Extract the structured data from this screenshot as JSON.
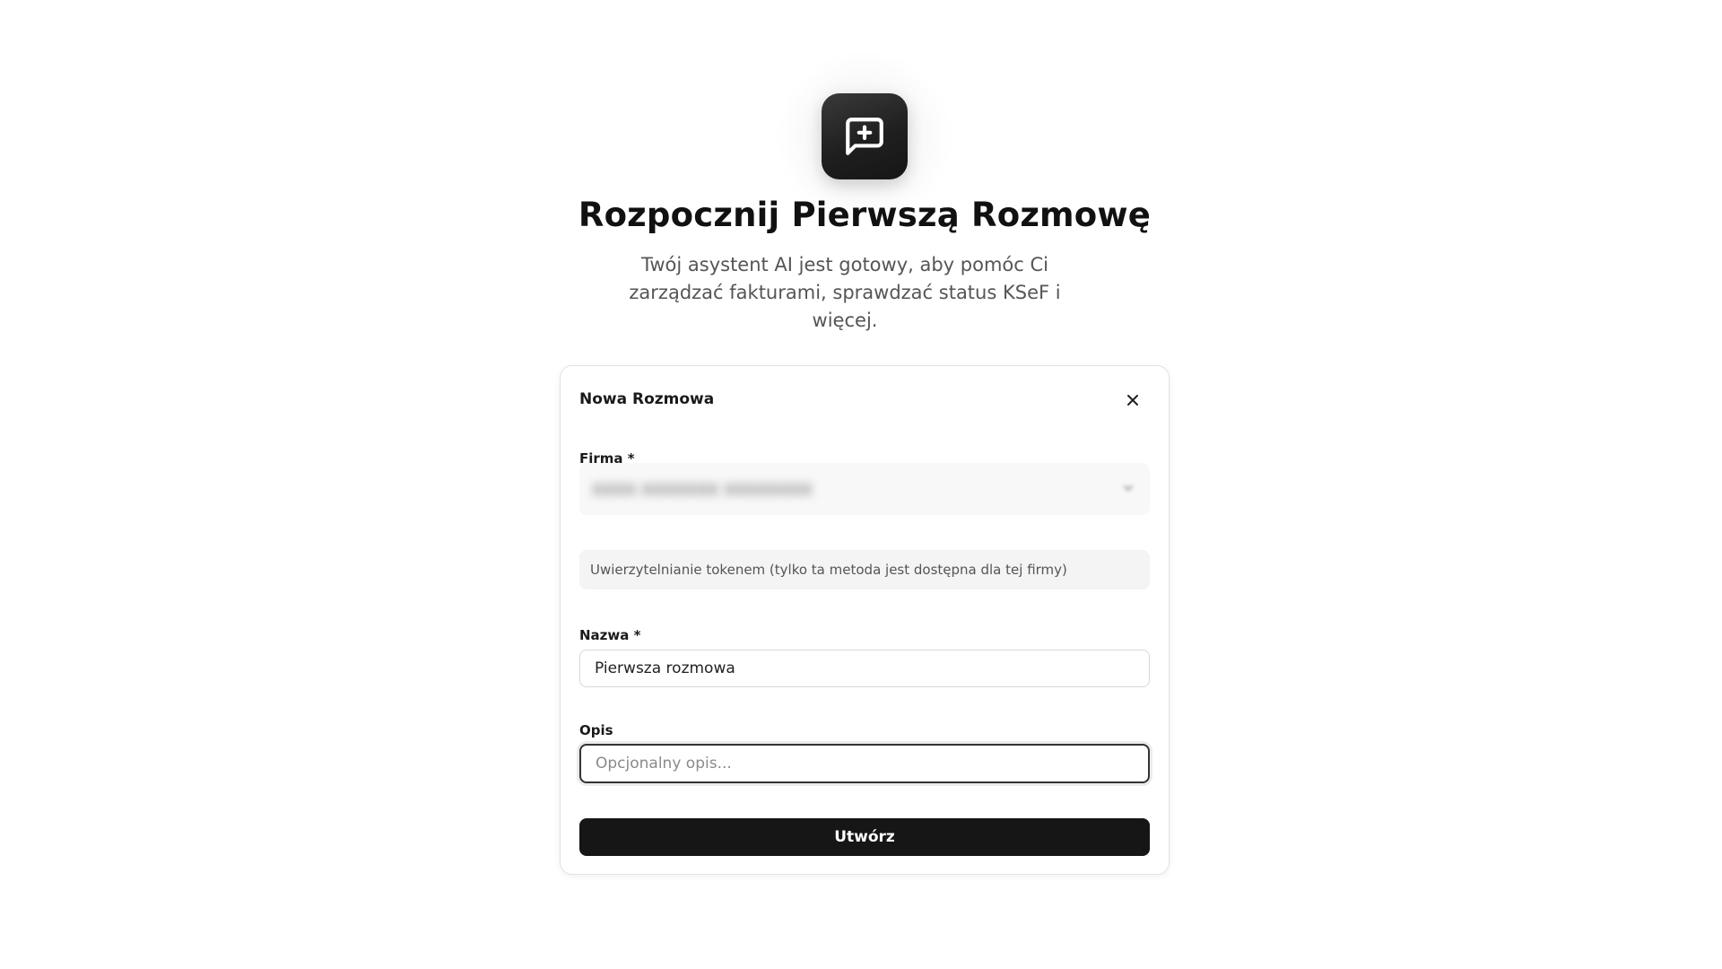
{
  "hero": {
    "icon": "message-plus-icon",
    "title": "Rozpocznij Pierwszą Rozmowę",
    "subtitle": "Twój asystent AI jest gotowy, aby pomóc Ci zarządzać fakturami, sprawdzać status KSeF i więcej."
  },
  "dialog": {
    "title": "Nowa Rozmowa",
    "close_icon": "close-icon",
    "company": {
      "label": "Firma *",
      "value": "XXXX XXXXXXX XXXXXXXX"
    },
    "auth_info": "Uwierzytelnianie tokenem (tylko ta metoda jest dostępna dla tej firmy)",
    "name": {
      "label": "Nazwa *",
      "value": "Pierwsza rozmowa"
    },
    "description": {
      "label": "Opis",
      "placeholder": "Opcjonalny opis..."
    },
    "submit_label": "Utwórz"
  },
  "colors": {
    "accent": "#161616",
    "background": "#ffffff",
    "muted_text": "#555555"
  }
}
